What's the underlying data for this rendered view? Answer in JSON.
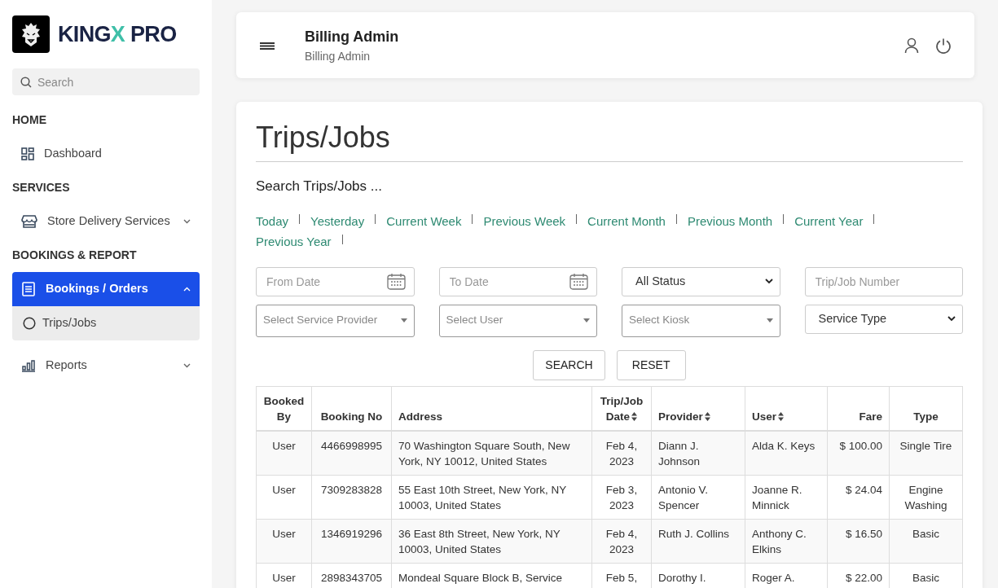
{
  "brand": {
    "name_parts": [
      {
        "text": "KING",
        "accent": false
      },
      {
        "text": "X",
        "accent": true
      },
      {
        "text": " PRO",
        "accent": false
      }
    ]
  },
  "sidebar": {
    "search": {
      "placeholder": "Search"
    },
    "sections": [
      {
        "heading": "HOME",
        "items": [
          {
            "label": "Dashboard",
            "selected": false
          }
        ]
      },
      {
        "heading": "SERVICES",
        "items": [
          {
            "label": "Store Delivery Services",
            "selected": false,
            "expandable": true,
            "expanded": false
          }
        ]
      },
      {
        "heading": "BOOKINGS & REPORT",
        "items": [
          {
            "label": "Bookings / Orders",
            "selected": true,
            "expandable": true,
            "expanded": true,
            "children": [
              {
                "label": "Trips/Jobs",
                "selected": true
              }
            ]
          },
          {
            "label": "Reports",
            "selected": false,
            "expandable": true,
            "expanded": false
          }
        ]
      }
    ]
  },
  "header": {
    "title": "Billing Admin",
    "subtitle": "Billing Admin"
  },
  "page": {
    "title": "Trips/Jobs",
    "search_heading": "Search Trips/Jobs ...",
    "quick_ranges": [
      "Today",
      "Yesterday",
      "Current Week",
      "Previous Week",
      "Current Month",
      "Previous Month",
      "Current Year",
      "Previous Year"
    ],
    "filters": [
      {
        "kind": "date",
        "placeholder": "From Date"
      },
      {
        "kind": "date",
        "placeholder": "To Date"
      },
      {
        "kind": "select",
        "value": "All Status"
      },
      {
        "kind": "text",
        "placeholder": "Trip/Job Number"
      },
      {
        "kind": "combo",
        "placeholder": "Select Service Provider"
      },
      {
        "kind": "combo",
        "placeholder": "Select User"
      },
      {
        "kind": "combo",
        "placeholder": "Select Kiosk"
      },
      {
        "kind": "select",
        "value": "Service Type"
      }
    ],
    "buttons": [
      "SEARCH",
      "RESET"
    ],
    "table": {
      "columns": [
        {
          "label": "Booked By",
          "sortable": false
        },
        {
          "label": "Booking No",
          "sortable": false
        },
        {
          "label": "Address",
          "sortable": false
        },
        {
          "label": "Trip/Job Date",
          "sortable": true
        },
        {
          "label": "Provider",
          "sortable": true
        },
        {
          "label": "User",
          "sortable": true
        },
        {
          "label": "Fare",
          "sortable": false
        },
        {
          "label": "Type",
          "sortable": false
        }
      ],
      "rows": [
        [
          "User",
          "4466998995",
          "70 Washington Square South, New York, NY 10012, United States",
          "Feb 4, 2023",
          "Diann J. Johnson",
          "Alda K. Keys",
          "$ 100.00",
          "Single Tire"
        ],
        [
          "User",
          "7309283828",
          "55 East 10th Street, New York, NY 10003, United States",
          "Feb 3, 2023",
          "Antonio V. Spencer",
          "Joanne R. Minnick",
          "$ 24.04",
          "Engine Washing"
        ],
        [
          "User",
          "1346919296",
          "36 East 8th Street, New York, NY 10003, United States",
          "Feb 4, 2023",
          "Ruth J. Collins",
          "Anthony C. Elkins",
          "$ 16.50",
          "Basic"
        ],
        [
          "User",
          "2898343705",
          "Mondeal Square Block B, Service",
          "Feb 5,",
          "Dorothy I.",
          "Roger A.",
          "$ 22.00",
          "Basic"
        ]
      ]
    }
  }
}
